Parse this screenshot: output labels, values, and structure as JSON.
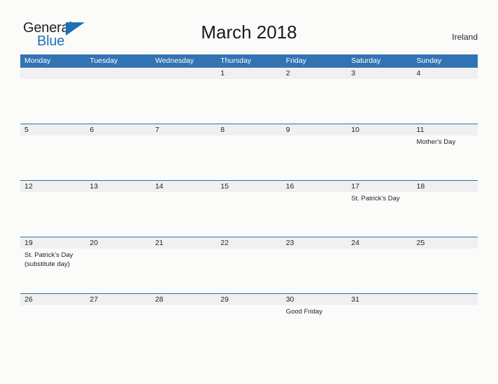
{
  "brand": {
    "name_part1": "General",
    "name_part2": "Blue",
    "triangle_color": "#1f6fb5"
  },
  "header": {
    "title": "March 2018",
    "country": "Ireland"
  },
  "theme": {
    "header_blue": "#3273b3",
    "row_rule": "#2f6fb0",
    "date_band": "#f0f0f0",
    "page_background": "#fbfbfa",
    "text": "#232323"
  },
  "calendar": {
    "weekdays": [
      "Monday",
      "Tuesday",
      "Wednesday",
      "Thursday",
      "Friday",
      "Saturday",
      "Sunday"
    ],
    "weeks": [
      [
        {
          "date": "",
          "events": []
        },
        {
          "date": "",
          "events": []
        },
        {
          "date": "",
          "events": []
        },
        {
          "date": "1",
          "events": []
        },
        {
          "date": "2",
          "events": []
        },
        {
          "date": "3",
          "events": []
        },
        {
          "date": "4",
          "events": []
        }
      ],
      [
        {
          "date": "5",
          "events": []
        },
        {
          "date": "6",
          "events": []
        },
        {
          "date": "7",
          "events": []
        },
        {
          "date": "8",
          "events": []
        },
        {
          "date": "9",
          "events": []
        },
        {
          "date": "10",
          "events": []
        },
        {
          "date": "11",
          "events": [
            "Mother's Day"
          ]
        }
      ],
      [
        {
          "date": "12",
          "events": []
        },
        {
          "date": "13",
          "events": []
        },
        {
          "date": "14",
          "events": []
        },
        {
          "date": "15",
          "events": []
        },
        {
          "date": "16",
          "events": []
        },
        {
          "date": "17",
          "events": [
            "St. Patrick's Day"
          ]
        },
        {
          "date": "18",
          "events": []
        }
      ],
      [
        {
          "date": "19",
          "events": [
            "St. Patrick's Day",
            "(substitute day)"
          ]
        },
        {
          "date": "20",
          "events": []
        },
        {
          "date": "21",
          "events": []
        },
        {
          "date": "22",
          "events": []
        },
        {
          "date": "23",
          "events": []
        },
        {
          "date": "24",
          "events": []
        },
        {
          "date": "25",
          "events": []
        }
      ],
      [
        {
          "date": "26",
          "events": []
        },
        {
          "date": "27",
          "events": []
        },
        {
          "date": "28",
          "events": []
        },
        {
          "date": "29",
          "events": []
        },
        {
          "date": "30",
          "events": [
            "Good Friday"
          ]
        },
        {
          "date": "31",
          "events": []
        },
        {
          "date": "",
          "events": []
        }
      ]
    ]
  }
}
